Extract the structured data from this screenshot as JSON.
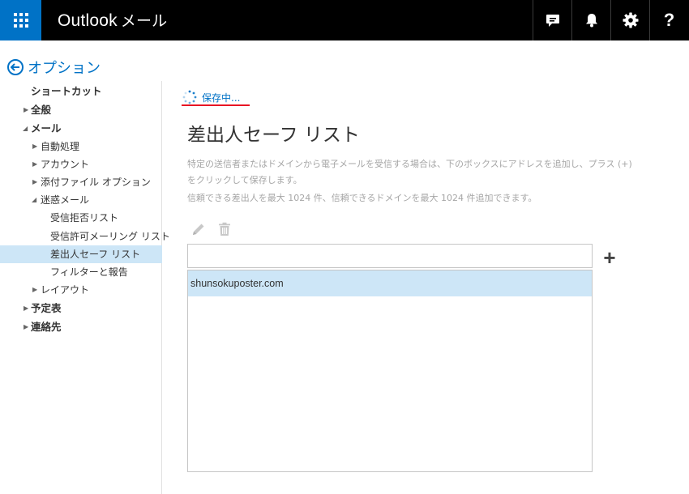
{
  "header": {
    "brand": "Outlook",
    "app": "メール",
    "icons": [
      "waffle-icon",
      "chat-icon",
      "bell-icon",
      "gear-icon",
      "help-icon"
    ],
    "help_glyph": "?"
  },
  "back_link": {
    "label": "オプション"
  },
  "nav": {
    "items": [
      {
        "label": "ショートカット"
      },
      {
        "label": "全般"
      },
      {
        "label": "メール"
      },
      {
        "label": "自動処理"
      },
      {
        "label": "アカウント"
      },
      {
        "label": "添付ファイル オプション"
      },
      {
        "label": "迷惑メール"
      },
      {
        "label": "受信拒否リスト"
      },
      {
        "label": "受信許可メーリング リスト"
      },
      {
        "label": "差出人セーフ リスト"
      },
      {
        "label": "フィルターと報告"
      },
      {
        "label": "レイアウト"
      },
      {
        "label": "予定表"
      },
      {
        "label": "連絡先"
      }
    ],
    "selected": "差出人セーフ リスト"
  },
  "content": {
    "status": "保存中...",
    "title": "差出人セーフ リスト",
    "description": [
      "特定の送信者またはドメインから電子メールを受信する場合は、下のボックスにアドレスを追加し、プラス (+)",
      "をクリックして保存します。",
      "信頼できる差出人を最大 1024 件、信頼できるドメインを最大 1024 件追加できます。"
    ],
    "input_value": "",
    "add_label": "+",
    "list": [
      "shunsokuposter.com"
    ]
  },
  "colors": {
    "accent": "#0072c6",
    "topbar": "#000000",
    "selected": "#cde6f7",
    "underline": "#e81123"
  }
}
